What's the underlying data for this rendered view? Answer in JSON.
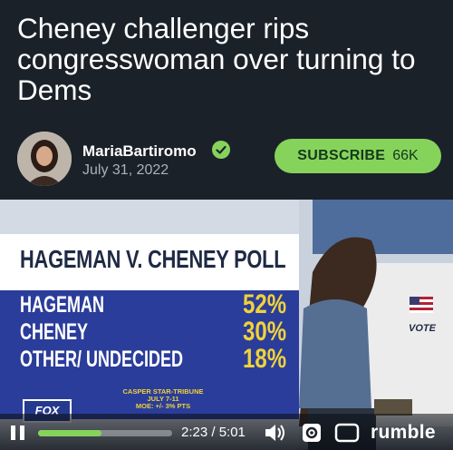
{
  "post": {
    "title": "Cheney challenger rips congresswoman over turning to Dems"
  },
  "channel": {
    "name": "MariaBartiromo",
    "date": "July 31, 2022",
    "subscribe_label": "SUBSCRIBE",
    "subscriber_count": "66K",
    "accent_color": "#86d35b"
  },
  "video": {
    "poll_title": "HAGEMAN V. CHENEY POLL",
    "poll_rows": [
      {
        "name": "HAGEMAN",
        "value": "52%"
      },
      {
        "name": "CHENEY",
        "value": "30%"
      },
      {
        "name": "OTHER/ UNDECIDED",
        "value": "18%"
      }
    ],
    "source_line1": "CASPER STAR-TRIBUNE",
    "source_line2": "JULY 7-11",
    "source_line3": "MOE: +/- 3% PTS",
    "network_logo": "FOX",
    "booth_sign": "VOTE"
  },
  "player": {
    "time": "2:23 / 5:01",
    "progress_fraction": 0.475,
    "brand": "rumble",
    "icons": [
      "pause-icon",
      "volume-icon",
      "settings-icon",
      "theater-mode-icon"
    ]
  }
}
